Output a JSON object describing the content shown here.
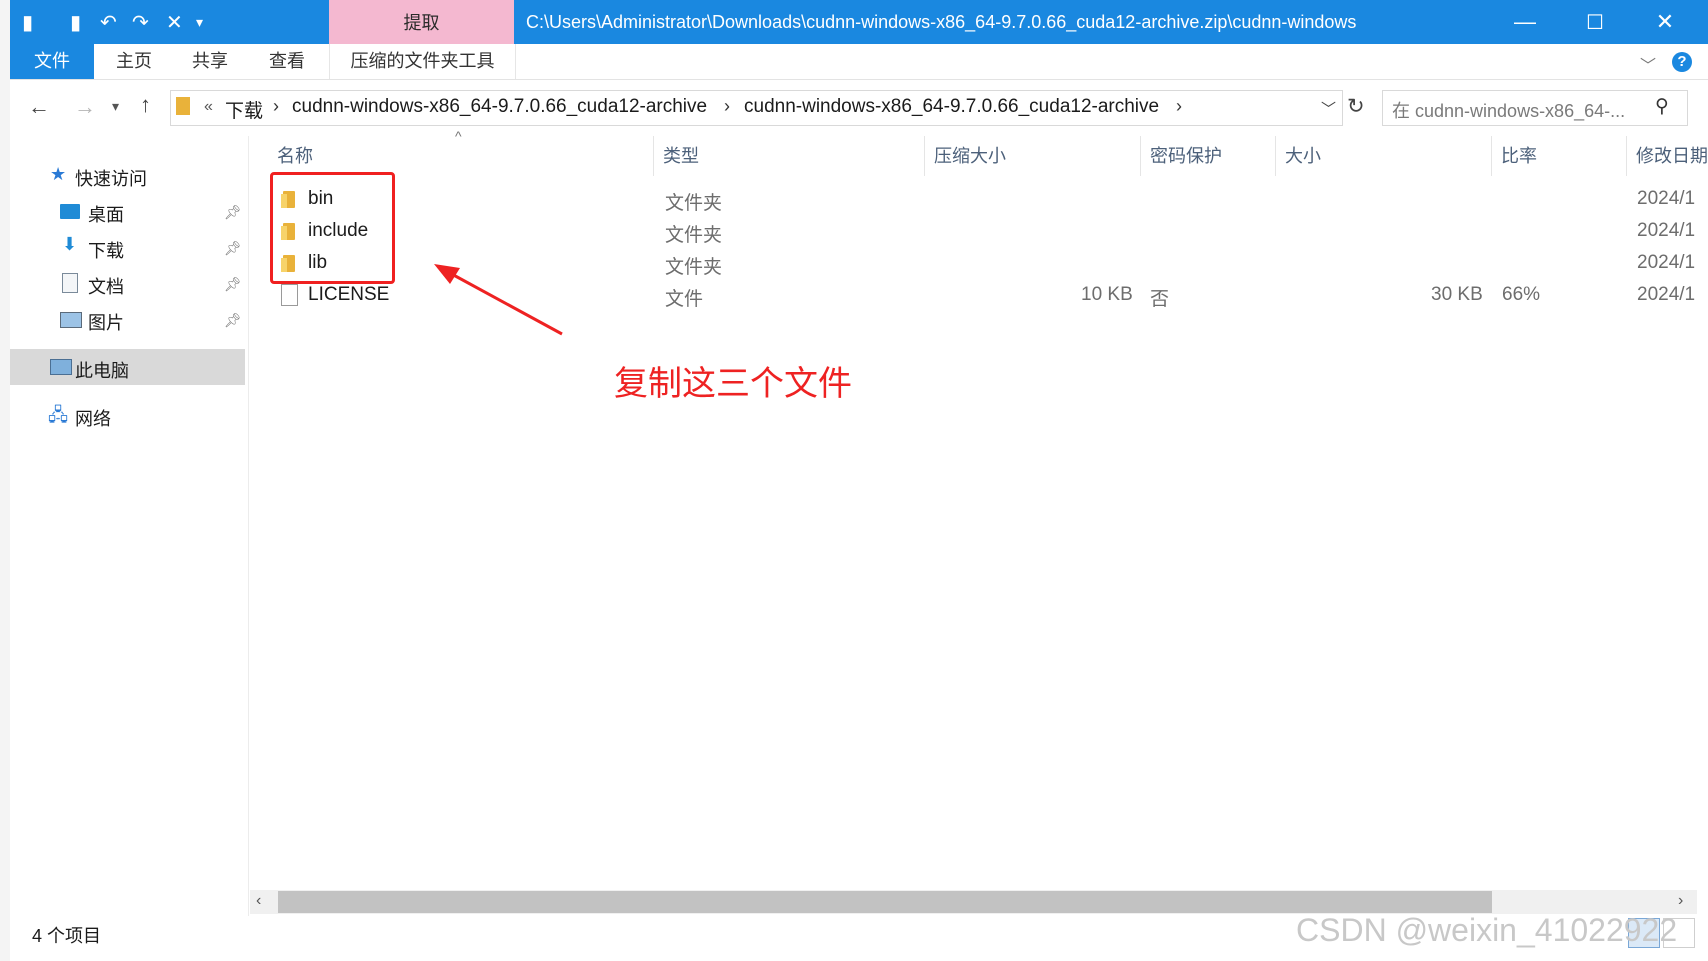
{
  "window": {
    "title_path": "C:\\Users\\Administrator\\Downloads\\cudnn-windows-x86_64-9.7.0.66_cuda12-archive.zip\\cudnn-windows",
    "context_tab": "提取",
    "controls": {
      "minimize": "—",
      "maximize": "☐",
      "close": "✕"
    }
  },
  "ribbon": {
    "tabs": [
      "文件",
      "主页",
      "共享",
      "查看",
      "压缩的文件夹工具"
    ],
    "help": "?"
  },
  "address": {
    "overflow": "«",
    "crumbs": [
      "下载",
      "cudnn-windows-x86_64-9.7.0.66_cuda12-archive",
      "cudnn-windows-x86_64-9.7.0.66_cuda12-archive"
    ],
    "search_placeholder": "在 cudnn-windows-x86_64-..."
  },
  "nav": {
    "quick_access": "快速访问",
    "items": [
      {
        "label": "桌面"
      },
      {
        "label": "下载"
      },
      {
        "label": "文档"
      },
      {
        "label": "图片"
      }
    ],
    "this_pc": "此电脑",
    "network": "网络"
  },
  "columns": [
    "名称",
    "类型",
    "压缩大小",
    "密码保护",
    "大小",
    "比率",
    "修改日期"
  ],
  "rows": [
    {
      "name": "bin",
      "type": "文件夹",
      "compressed": "",
      "password": "",
      "size": "",
      "ratio": "",
      "modified": "2024/1",
      "kind": "folder"
    },
    {
      "name": "include",
      "type": "文件夹",
      "compressed": "",
      "password": "",
      "size": "",
      "ratio": "",
      "modified": "2024/1",
      "kind": "folder"
    },
    {
      "name": "lib",
      "type": "文件夹",
      "compressed": "",
      "password": "",
      "size": "",
      "ratio": "",
      "modified": "2024/1",
      "kind": "folder"
    },
    {
      "name": "LICENSE",
      "type": "文件",
      "compressed": "10 KB",
      "password": "否",
      "size": "30 KB",
      "ratio": "66%",
      "modified": "2024/1",
      "kind": "file"
    }
  ],
  "annotation": {
    "text": "复制这三个文件",
    "color": "#ee2222"
  },
  "status": {
    "count": "4 个项目"
  },
  "watermark": "CSDN @weixin_41022922",
  "colors": {
    "accent": "#1a88e0",
    "context_tab": "#f4b8d0"
  }
}
